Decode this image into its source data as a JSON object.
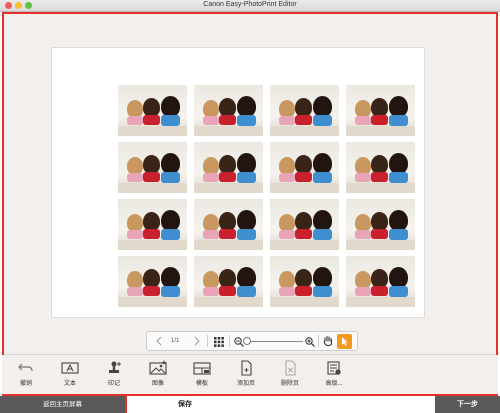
{
  "window": {
    "title": "Canon Easy-PhotoPrint Editor",
    "traffic_lights": [
      "close",
      "minimize",
      "zoom"
    ]
  },
  "canvas": {
    "photo_rows": 4,
    "photo_cols": 4,
    "photo_subject": "three dogs photo"
  },
  "navigation": {
    "prev_icon": "chevron-left-icon",
    "page_indicator": "1/1",
    "next_icon": "chevron-right-icon",
    "grid_icon": "grid-view-icon",
    "zoom_out_icon": "zoom-out-icon",
    "zoom_in_icon": "zoom-in-icon",
    "zoom_level": 0,
    "hand_icon": "hand-tool-icon",
    "select_icon": "select-arrow-icon",
    "accent": "#f29a1f"
  },
  "toolbar": {
    "items": [
      {
        "label": "撤销",
        "icon": "undo-icon"
      },
      {
        "label": "文本",
        "icon": "text-box-icon"
      },
      {
        "label": "印记",
        "icon": "stamp-icon"
      },
      {
        "label": "图像",
        "icon": "image-icon"
      },
      {
        "label": "模板",
        "icon": "template-icon"
      },
      {
        "label": "添加页",
        "icon": "add-page-icon"
      },
      {
        "label": "删除页",
        "icon": "delete-page-icon"
      },
      {
        "label": "高级...",
        "icon": "advanced-icon"
      }
    ]
  },
  "bottom": {
    "home_label": "返回主页屏幕",
    "save_label": "保存",
    "next_label": "下一步"
  },
  "colors": {
    "frame_border": "#e5312b",
    "bottom_dark": "#5a5858"
  }
}
